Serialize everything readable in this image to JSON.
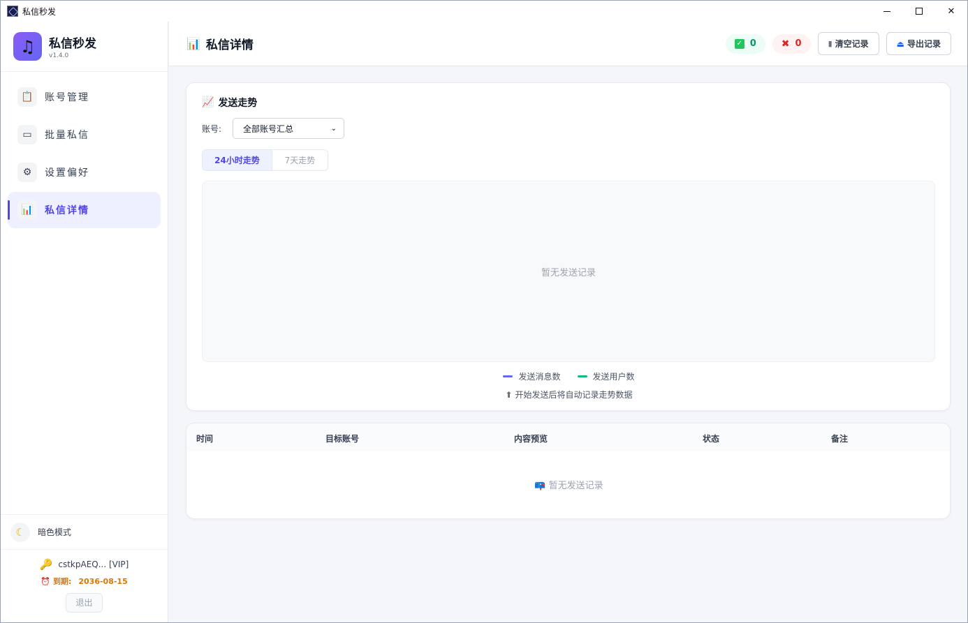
{
  "window": {
    "title": "私信秒发"
  },
  "brand": {
    "name": "私信秒发",
    "version": "v1.4.0"
  },
  "nav": {
    "items": [
      {
        "label": "账号管理",
        "icon": "clipboard-icon"
      },
      {
        "label": "批量私信",
        "icon": "message-box-icon"
      },
      {
        "label": "设置偏好",
        "icon": "gear-icon"
      },
      {
        "label": "私信详情",
        "icon": "bar-chart-icon",
        "active": true
      }
    ]
  },
  "sidebar_bottom": {
    "dark_mode_label": "暗色模式",
    "account_label": "cstkpAEQ... [VIP]",
    "expire_label": "到期:",
    "expire_date": "2036-08-15",
    "logout_label": "退出"
  },
  "header": {
    "title": "私信详情",
    "success_count": "0",
    "fail_count": "0",
    "clear_label": "清空记录",
    "export_label": "导出记录"
  },
  "trend": {
    "title": "发送走势",
    "account_label": "账号:",
    "account_selected": "全部账号汇总",
    "tabs": [
      "24小时走势",
      "7天走势"
    ],
    "active_tab": 0,
    "empty_text": "暂无发送记录",
    "legend": [
      {
        "name": "发送消息数",
        "color": "#6366f1"
      },
      {
        "name": "发送用户数",
        "color": "#10b981"
      }
    ],
    "hint": "开始发送后将自动记录走势数据"
  },
  "table": {
    "columns": [
      "时间",
      "目标账号",
      "内容预览",
      "状态",
      "备注"
    ],
    "empty_text": "暂无发送记录"
  },
  "colors": {
    "accent": "#4f46e5",
    "success": "#059669",
    "danger": "#dc2626",
    "warning": "#d97706"
  }
}
